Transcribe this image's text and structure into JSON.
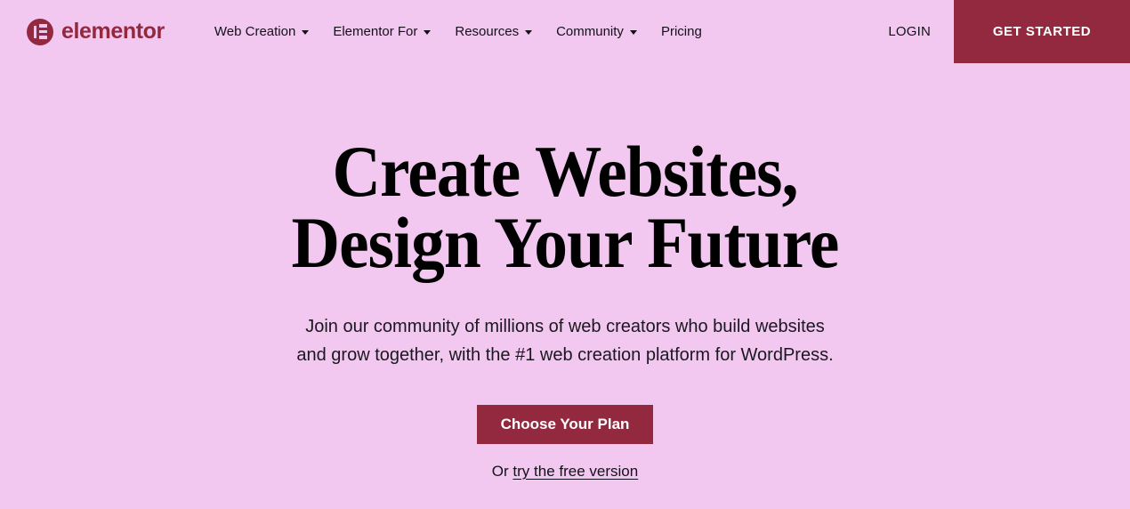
{
  "colors": {
    "background": "#f2c7f0",
    "brand": "#92293f",
    "text": "#13111a",
    "button_text": "#ffffff"
  },
  "header": {
    "brand": {
      "name": "elementor",
      "mark_icon": "elementor-logo-icon"
    },
    "nav": [
      {
        "label": "Web Creation",
        "has_dropdown": true
      },
      {
        "label": "Elementor For",
        "has_dropdown": true
      },
      {
        "label": "Resources",
        "has_dropdown": true
      },
      {
        "label": "Community",
        "has_dropdown": true
      },
      {
        "label": "Pricing",
        "has_dropdown": false
      }
    ],
    "login_label": "LOGIN",
    "get_started_label": "GET STARTED"
  },
  "hero": {
    "title_line1": "Create Websites,",
    "title_line2": "Design Your Future",
    "subtitle_line1": "Join our community of millions of web creators who build websites",
    "subtitle_line2": "and grow together, with the #1 web creation platform for WordPress.",
    "cta_label": "Choose Your Plan",
    "free_prefix": "Or ",
    "free_link_label": "try the free version"
  }
}
